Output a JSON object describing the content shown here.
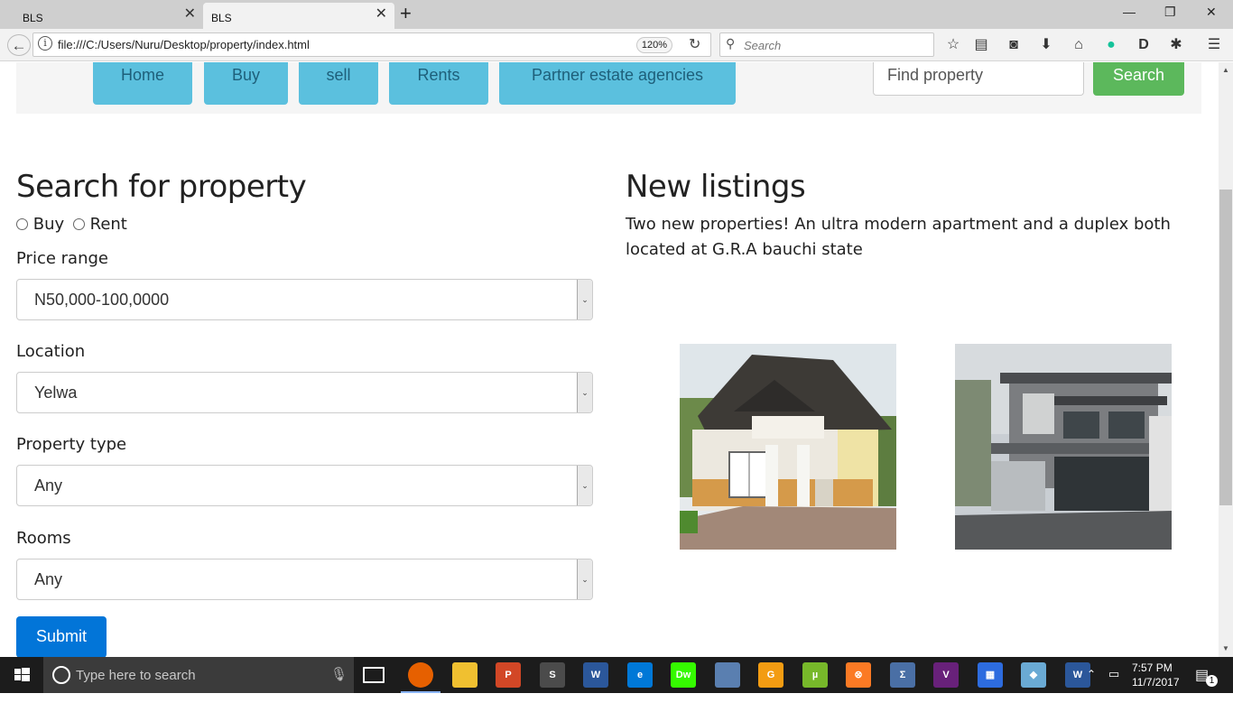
{
  "browser": {
    "tabs": [
      {
        "label": "BLS"
      },
      {
        "label": "BLS"
      }
    ],
    "new_tab": "+",
    "url": "file:///C:/Users/Nuru/Desktop/property/index.html",
    "zoom": "120%",
    "search_placeholder": "Search",
    "win_controls": {
      "minimize": "—",
      "restore": "❐",
      "close": "✕"
    }
  },
  "site": {
    "nav": [
      "Home",
      "Buy",
      "sell",
      "Rents",
      "Partner estate agencies"
    ],
    "find_placeholder": "Find property",
    "search_button": "Search"
  },
  "search_form": {
    "title": "Search for property",
    "radio_buy": "Buy",
    "radio_rent": "Rent",
    "price_label": "Price range",
    "price_value": "N50,000-100,0000",
    "location_label": "Location",
    "location_value": "Yelwa",
    "type_label": "Property type",
    "type_value": "Any",
    "rooms_label": "Rooms",
    "rooms_value": "Any",
    "submit": "Submit"
  },
  "listings": {
    "title": "New listings",
    "text": "Two new properties! An ultra modern apartment and a duplex both located at G.R.A bauchi state"
  },
  "taskbar": {
    "search_placeholder": "Type here to search",
    "time": "7:57 PM",
    "date": "11/7/2017",
    "notification_count": "1",
    "apps": [
      {
        "name": "firefox",
        "label": "",
        "color": "#e66000"
      },
      {
        "name": "file-explorer",
        "label": "",
        "color": "#f0c030"
      },
      {
        "name": "powerpoint",
        "label": "P",
        "color": "#d24726"
      },
      {
        "name": "sublime-text",
        "label": "S",
        "color": "#4b4b4b"
      },
      {
        "name": "word",
        "label": "W",
        "color": "#2b579a"
      },
      {
        "name": "edge",
        "label": "e",
        "color": "#0078d7"
      },
      {
        "name": "dreamweaver",
        "label": "Dw",
        "color": "#35fa00"
      },
      {
        "name": "browser",
        "label": "",
        "color": "#5a7fb0"
      },
      {
        "name": "app-g",
        "label": "G",
        "color": "#f39c12"
      },
      {
        "name": "utorrent",
        "label": "µ",
        "color": "#77b82a"
      },
      {
        "name": "xampp",
        "label": "⊗",
        "color": "#fb7a24"
      },
      {
        "name": "app-sigma",
        "label": "Σ",
        "color": "#4a6fa5"
      },
      {
        "name": "visual-studio",
        "label": "V",
        "color": "#68217a"
      },
      {
        "name": "calculator",
        "label": "▦",
        "color": "#2d6cdf"
      },
      {
        "name": "virtualbox",
        "label": "◆",
        "color": "#6aaad4"
      },
      {
        "name": "word-2",
        "label": "W",
        "color": "#2b579a"
      }
    ]
  }
}
